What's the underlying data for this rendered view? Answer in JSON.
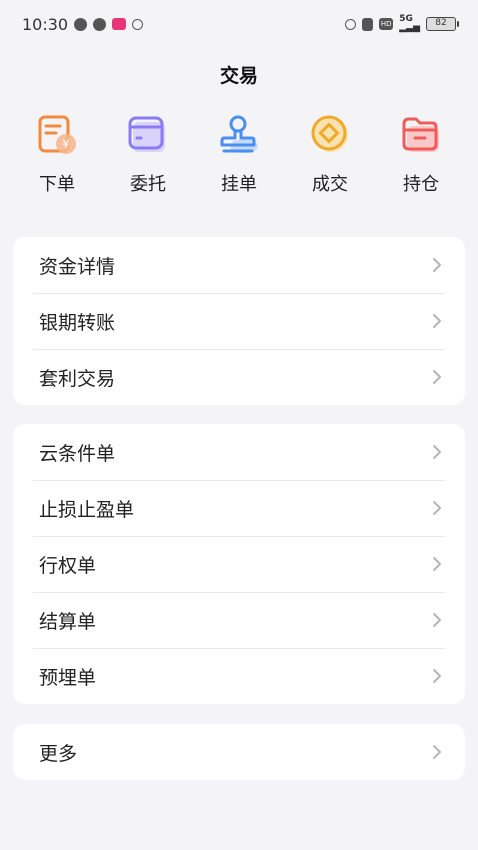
{
  "status": {
    "time": "10:30",
    "net": "5G",
    "hd": "HD",
    "battery": "82"
  },
  "header": {
    "title": "交易"
  },
  "quick_actions": [
    {
      "label": "下单",
      "icon": "order-receipt-icon"
    },
    {
      "label": "委托",
      "icon": "entrust-card-icon"
    },
    {
      "label": "挂单",
      "icon": "stamp-icon"
    },
    {
      "label": "成交",
      "icon": "coin-icon"
    },
    {
      "label": "持仓",
      "icon": "folder-icon"
    }
  ],
  "group1": [
    "资金详情",
    "银期转账",
    "套利交易"
  ],
  "group2": [
    "云条件单",
    "止损止盈单",
    "行权单",
    "结算单",
    "预埋单"
  ],
  "group3": [
    "更多"
  ],
  "colors": {
    "accent_orange": "#f08a3c",
    "accent_purple": "#8a7cf0",
    "accent_blue": "#4a8ef0",
    "accent_gold": "#f0a92a",
    "accent_red": "#ef5b5b"
  }
}
